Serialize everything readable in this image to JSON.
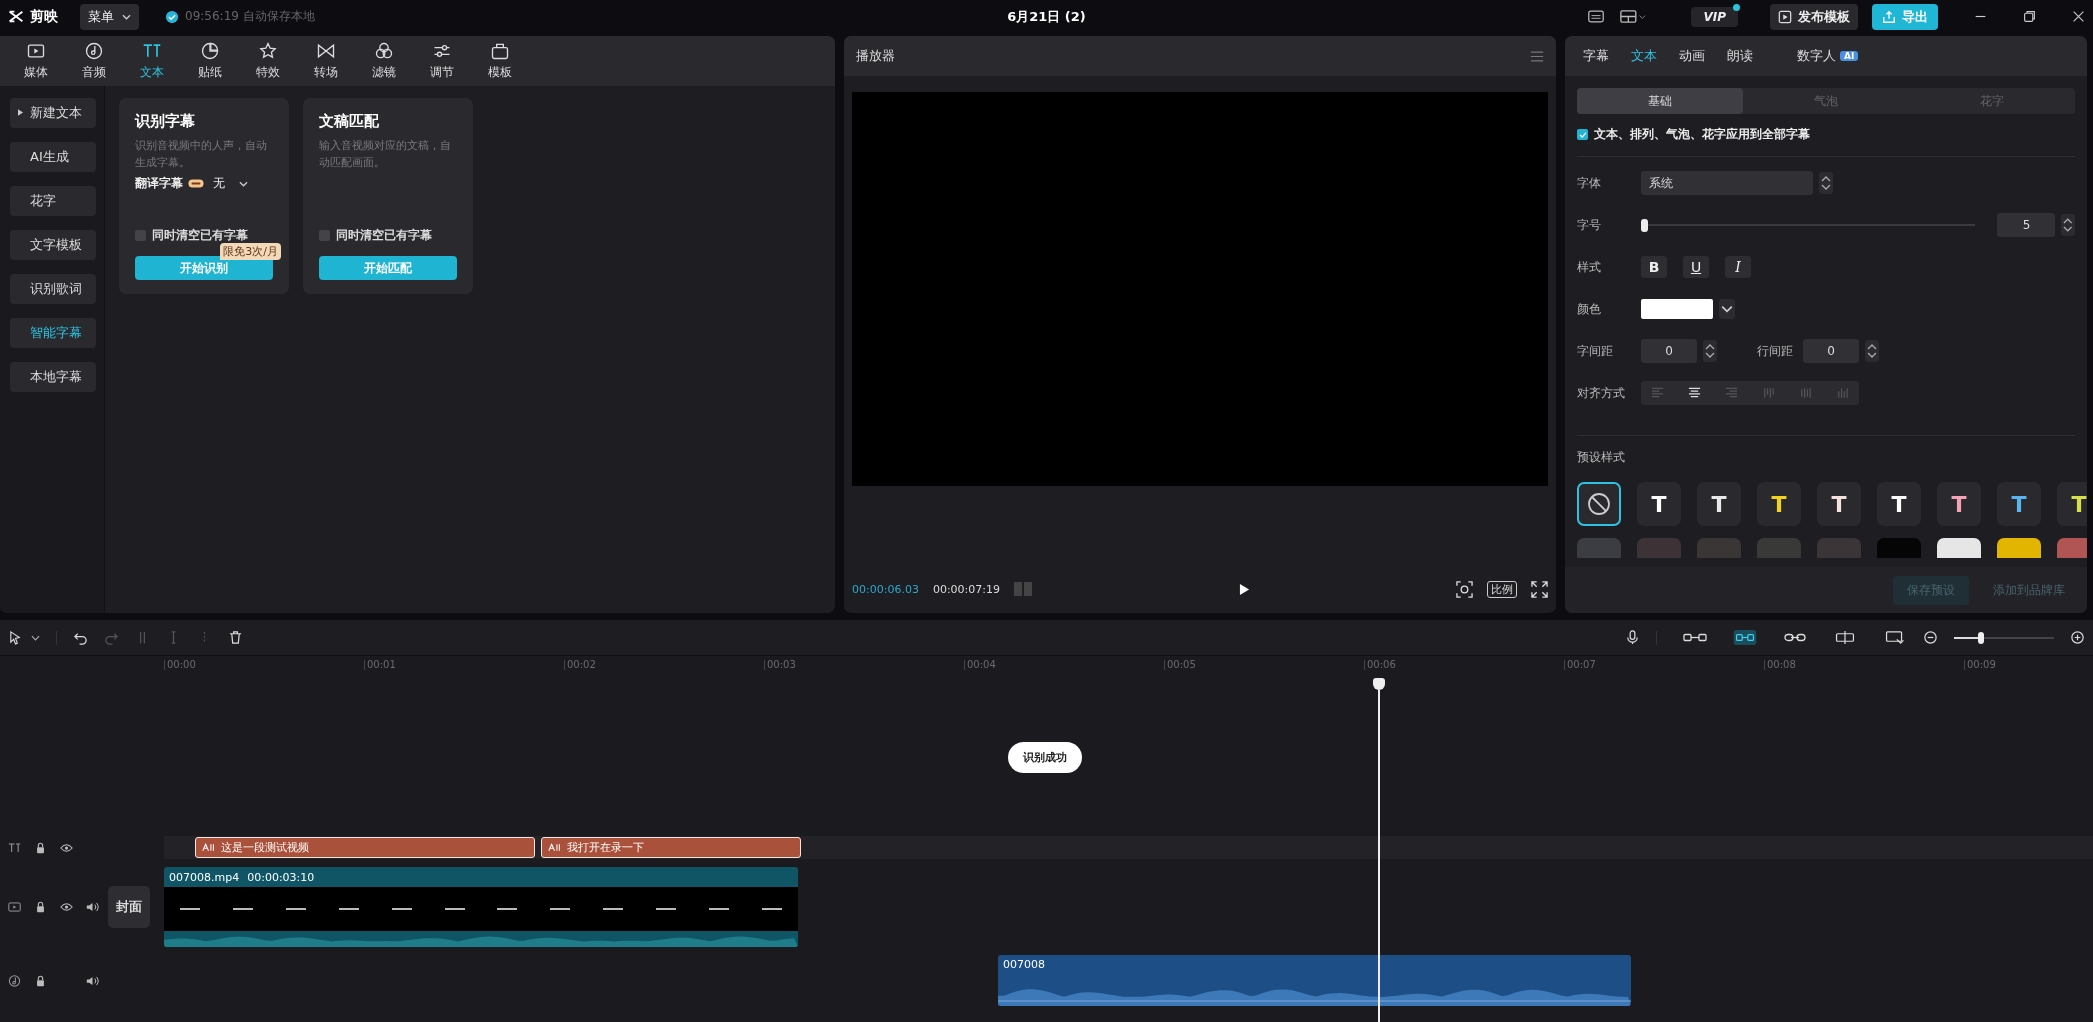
{
  "topbar": {
    "logo": "剪映",
    "menu": "菜单",
    "autosave": "09:56:19 自动保存本地",
    "title": "6月21日 (2)",
    "vip": "VIP",
    "publish": "发布模板",
    "export": "导出"
  },
  "media_tabs": [
    {
      "label": "媒体",
      "selected": false
    },
    {
      "label": "音频",
      "selected": false
    },
    {
      "label": "文本",
      "selected": true
    },
    {
      "label": "贴纸",
      "selected": false
    },
    {
      "label": "特效",
      "selected": false
    },
    {
      "label": "转场",
      "selected": false
    },
    {
      "label": "滤镜",
      "selected": false
    },
    {
      "label": "调节",
      "selected": false
    },
    {
      "label": "模板",
      "selected": false
    }
  ],
  "text_sidebar": [
    {
      "label": "新建文本",
      "selected": false,
      "has_children": true
    },
    {
      "label": "AI生成",
      "selected": false,
      "has_children": false
    },
    {
      "label": "花字",
      "selected": false,
      "has_children": false
    },
    {
      "label": "文字模板",
      "selected": false,
      "has_children": false
    },
    {
      "label": "识别歌词",
      "selected": false,
      "has_children": false
    },
    {
      "label": "智能字幕",
      "selected": true,
      "has_children": false
    },
    {
      "label": "本地字幕",
      "selected": false,
      "has_children": false
    }
  ],
  "cards": [
    {
      "title": "识别字幕",
      "description": "识别音视频中的人声，自动生成字幕。",
      "translate_label": "翻译字幕",
      "translate_value": "无",
      "checkbox_label": "同时清空已有字幕",
      "checked": false,
      "badge": "限免3次/月",
      "button": "开始识别"
    },
    {
      "title": "文稿匹配",
      "description": "输入音视频对应的文稿，自动匹配画面。",
      "checkbox_label": "同时清空已有字幕",
      "checked": false,
      "button": "开始匹配"
    }
  ],
  "player": {
    "title": "播放器",
    "current_time": "00:00:06.03",
    "total_time": "00:00:07:19",
    "ratio": "比例"
  },
  "inspector": {
    "tabs": [
      {
        "label": "字幕",
        "selected": false
      },
      {
        "label": "文本",
        "selected": true
      },
      {
        "label": "动画",
        "selected": false
      },
      {
        "label": "朗读",
        "selected": false
      },
      {
        "label": "数字人",
        "selected": false,
        "badge": "AI"
      }
    ],
    "subtabs": [
      {
        "label": "基础",
        "selected": true
      },
      {
        "label": "气泡",
        "selected": false
      },
      {
        "label": "花字",
        "selected": false
      }
    ],
    "apply_all": {
      "label": "文本、排列、气泡、花字应用到全部字幕",
      "checked": true
    },
    "font": {
      "label": "字体",
      "value": "系统"
    },
    "size": {
      "label": "字号",
      "level": 0,
      "value": "5"
    },
    "style": {
      "label": "样式",
      "buttons": [
        {
          "label": "B",
          "kind": "bold"
        },
        {
          "label": "U",
          "kind": "underline"
        },
        {
          "label": "I",
          "kind": "italic"
        }
      ]
    },
    "color": {
      "label": "颜色",
      "color": "#ffffff"
    },
    "letter_spacing": {
      "label": "字间距",
      "value": "0"
    },
    "line_spacing": {
      "label": "行间距",
      "value": "0"
    },
    "align": {
      "label": "对齐方式",
      "options": [
        {
          "selected": false
        },
        {
          "selected": true
        },
        {
          "selected": false
        },
        {
          "selected": false
        },
        {
          "selected": false
        },
        {
          "selected": false
        }
      ]
    },
    "presets": {
      "label": "预设样式",
      "items": [
        {
          "kind": "none",
          "selected": true
        },
        {
          "kind": "text",
          "label": "T",
          "color": "#ffffff",
          "selected": false
        },
        {
          "kind": "text",
          "label": "T",
          "color": "#e8e8e8",
          "selected": false
        },
        {
          "kind": "text",
          "label": "T",
          "color": "#f2d21b",
          "selected": false
        },
        {
          "kind": "text",
          "label": "T",
          "color": "#f5e0dc",
          "selected": false
        },
        {
          "kind": "text",
          "label": "T",
          "color": "#ffffff",
          "selected": false
        },
        {
          "kind": "text",
          "label": "T",
          "color": "#f4a3b5",
          "selected": false
        },
        {
          "kind": "text",
          "label": "T",
          "color": "#5ab4f0",
          "selected": false
        },
        {
          "kind": "text",
          "label": "T",
          "color": "#d6e04a",
          "selected": false
        }
      ],
      "more_swatches": [
        {
          "color": "#3b3d42"
        },
        {
          "color": "#3d3337"
        },
        {
          "color": "#3b3636"
        },
        {
          "color": "#393938"
        },
        {
          "color": "#3b3538"
        },
        {
          "color": "#050505"
        },
        {
          "color": "#e6e6e6"
        },
        {
          "color": "#e2b500"
        },
        {
          "color": "#b05454"
        }
      ]
    },
    "footer": [
      {
        "label": "保存预设",
        "disabled": true
      },
      {
        "label": "添加到品牌库",
        "disabled": true
      }
    ]
  },
  "timeline": {
    "zoom": {
      "level": 0.25
    },
    "ruler": [
      "00:00",
      "00:01",
      "00:02",
      "00:03",
      "00:04",
      "00:05",
      "00:06",
      "00:07",
      "00:08",
      "00:09"
    ],
    "toast": "识别成功",
    "text_clips": [
      {
        "label": "这是一段测试视频"
      },
      {
        "label": "我打开在录一下"
      }
    ],
    "cover": "封面",
    "video_clip": {
      "name": "007008.mp4",
      "duration": "00:00:03:10"
    },
    "audio_clip": {
      "name": "007008"
    }
  }
}
